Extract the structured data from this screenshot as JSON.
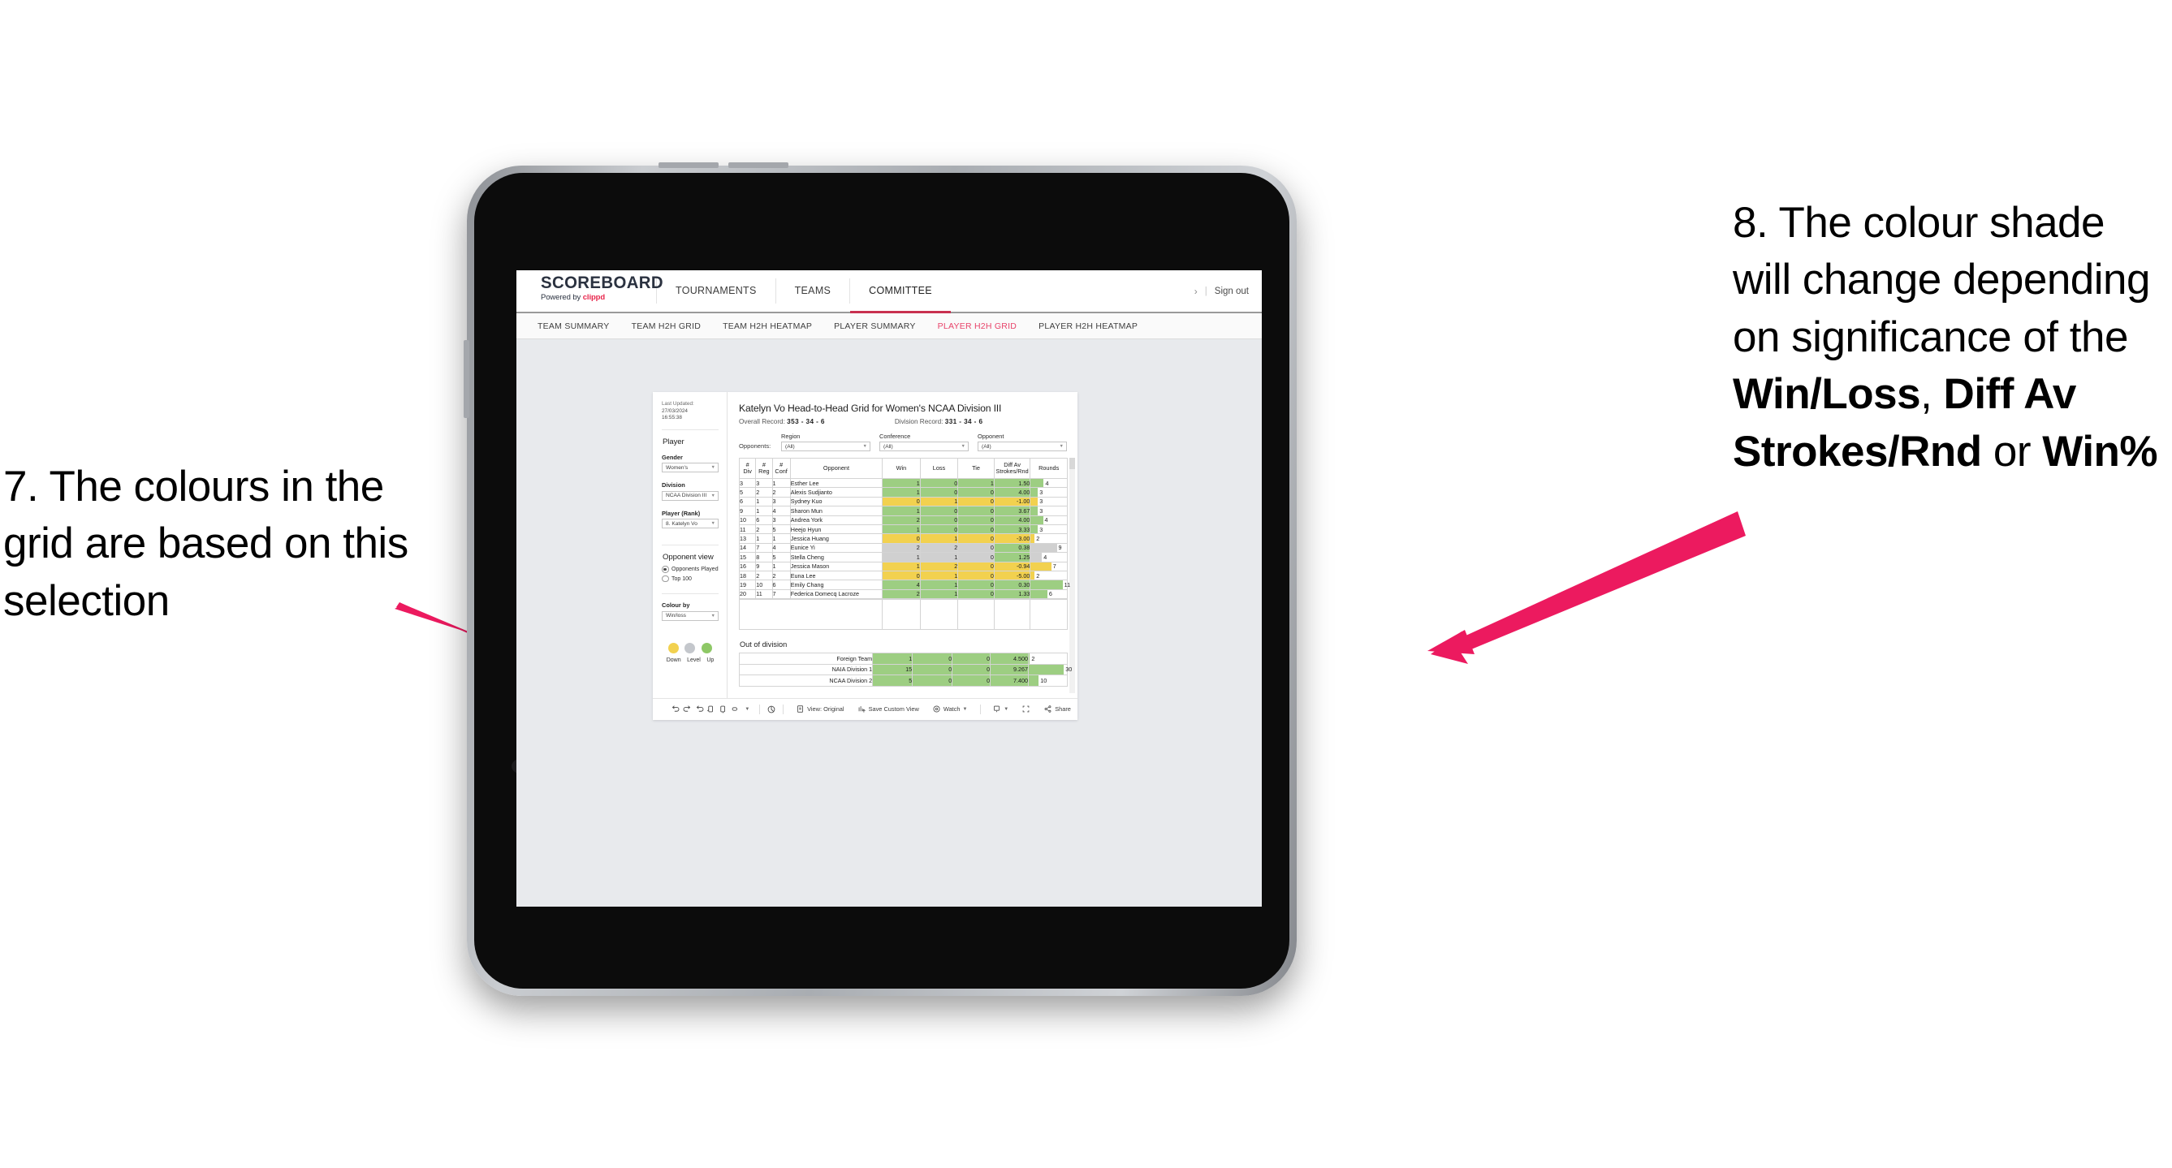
{
  "annotations": {
    "left": {
      "name": "annotation-7",
      "text": "7. The colours in the grid are based on this selection"
    },
    "right": {
      "name": "annotation-8",
      "prefix": "8. The colour shade will change depending on significance of the ",
      "bold1": "Win/Loss",
      "mid1": ", ",
      "bold2": "Diff Av Strokes/Rnd",
      "mid2": " or ",
      "bold3": "Win%"
    },
    "arrow_color": "#ec1a5f"
  },
  "app": {
    "brand": {
      "name": "SCOREBOARD",
      "powered_by": "Powered by ",
      "vendor": "clippd"
    },
    "top_nav": [
      {
        "label": "TOURNAMENTS",
        "active": false
      },
      {
        "label": "TEAMS",
        "active": false
      },
      {
        "label": "COMMITTEE",
        "active": true
      }
    ],
    "account": {
      "chevron": "›",
      "divider": "|",
      "sign_out": "Sign out"
    },
    "sub_nav": [
      {
        "label": "TEAM SUMMARY",
        "active": false
      },
      {
        "label": "TEAM H2H GRID",
        "active": false
      },
      {
        "label": "TEAM H2H HEATMAP",
        "active": false
      },
      {
        "label": "PLAYER SUMMARY",
        "active": false
      },
      {
        "label": "PLAYER H2H GRID",
        "active": true
      },
      {
        "label": "PLAYER H2H HEATMAP",
        "active": false
      }
    ]
  },
  "panel": {
    "last_updated_label": "Last Updated: ",
    "last_updated_value": "27/03/2024",
    "last_updated_time": "16:55:38",
    "heading": "Player",
    "fields": [
      {
        "label": "Gender",
        "value": "Women's"
      },
      {
        "label": "Division",
        "value": "NCAA Division III"
      },
      {
        "label": "Player (Rank)",
        "value": "8. Katelyn Vo"
      }
    ],
    "opponent_view": {
      "heading": "Opponent view",
      "options": [
        {
          "label": "Opponents Played",
          "selected": true
        },
        {
          "label": "Top 100",
          "selected": false
        }
      ]
    },
    "colour_by": {
      "label": "Colour by",
      "value": "Win/loss"
    },
    "legend": [
      {
        "label": "Down",
        "color": "#f2d14f"
      },
      {
        "label": "Level",
        "color": "#c4c7cc"
      },
      {
        "label": "Up",
        "color": "#8ec866"
      }
    ]
  },
  "main": {
    "title": "Katelyn Vo Head-to-Head Grid for Women's NCAA Division III",
    "overall_record_label": "Overall Record: ",
    "overall_record_value": "353 -  34 - 6",
    "division_record_label": "Division Record: ",
    "division_record_value": "331 -  34 - 6",
    "opponents_label": "Opponents:",
    "opponent_filters": [
      {
        "title": "Region",
        "value": "(All)"
      },
      {
        "title": "Conference",
        "value": "(All)"
      },
      {
        "title": "Opponent",
        "value": "(All)"
      }
    ],
    "out_of_division_title": "Out of division"
  },
  "chart_data": {
    "type": "table",
    "title": "Katelyn Vo Head-to-Head Grid for Women's NCAA Division III",
    "columns": [
      "# Div",
      "# Reg",
      "# Conf",
      "Opponent",
      "Win",
      "Loss",
      "Tie",
      "Diff Av Strokes/Rnd",
      "Rounds"
    ],
    "header_lines": [
      [
        "#",
        "Div"
      ],
      [
        "#",
        "Reg"
      ],
      [
        "#",
        "Conf"
      ],
      [
        "Opponent"
      ],
      [
        "Win"
      ],
      [
        "Loss"
      ],
      [
        "Tie"
      ],
      [
        "Diff Av",
        "Strokes/Rnd"
      ],
      [
        "Rounds"
      ]
    ],
    "color_scale": {
      "up": "#9dce82",
      "level": "#d0d0d0",
      "down": "#f2d14f"
    },
    "rows": [
      {
        "div": "3",
        "reg": "3",
        "conf": "1",
        "opponent": "Esther Lee",
        "win": "1",
        "loss": "0",
        "tie": "1",
        "diff": "1.50",
        "rounds": "4",
        "shade": "green",
        "bar_pct": 36
      },
      {
        "div": "5",
        "reg": "2",
        "conf": "2",
        "opponent": "Alexis Sudjianto",
        "win": "1",
        "loss": "0",
        "tie": "0",
        "diff": "4.00",
        "rounds": "3",
        "shade": "green",
        "bar_pct": 20
      },
      {
        "div": "6",
        "reg": "1",
        "conf": "3",
        "opponent": "Sydney Kuo",
        "win": "0",
        "loss": "1",
        "tie": "0",
        "diff": "-1.00",
        "rounds": "3",
        "shade": "yellow",
        "bar_pct": 20
      },
      {
        "div": "9",
        "reg": "1",
        "conf": "4",
        "opponent": "Sharon Mun",
        "win": "1",
        "loss": "0",
        "tie": "0",
        "diff": "3.67",
        "rounds": "3",
        "shade": "green",
        "bar_pct": 20
      },
      {
        "div": "10",
        "reg": "6",
        "conf": "3",
        "opponent": "Andrea York",
        "win": "2",
        "loss": "0",
        "tie": "0",
        "diff": "4.00",
        "rounds": "4",
        "shade": "green",
        "bar_pct": 34
      },
      {
        "div": "11",
        "reg": "2",
        "conf": "5",
        "opponent": "Heejo Hyun",
        "win": "1",
        "loss": "0",
        "tie": "0",
        "diff": "3.33",
        "rounds": "3",
        "shade": "green",
        "bar_pct": 20
      },
      {
        "div": "13",
        "reg": "1",
        "conf": "1",
        "opponent": "Jessica Huang",
        "win": "0",
        "loss": "1",
        "tie": "0",
        "diff": "-3.00",
        "rounds": "2",
        "shade": "yellow",
        "bar_pct": 11
      },
      {
        "div": "14",
        "reg": "7",
        "conf": "4",
        "opponent": "Eunice Yi",
        "win": "2",
        "loss": "2",
        "tie": "0",
        "diff": "0.38",
        "rounds": "9",
        "shade": "grey",
        "bar_pct": 72
      },
      {
        "div": "15",
        "reg": "8",
        "conf": "5",
        "opponent": "Stella Cheng",
        "win": "1",
        "loss": "1",
        "tie": "0",
        "diff": "1.25",
        "rounds": "4",
        "shade": "grey",
        "bar_pct": 31
      },
      {
        "div": "16",
        "reg": "9",
        "conf": "1",
        "opponent": "Jessica Mason",
        "win": "1",
        "loss": "2",
        "tie": "0",
        "diff": "-0.94",
        "rounds": "7",
        "shade": "yellow",
        "bar_pct": 57
      },
      {
        "div": "18",
        "reg": "2",
        "conf": "2",
        "opponent": "Euna Lee",
        "win": "0",
        "loss": "1",
        "tie": "0",
        "diff": "-5.00",
        "rounds": "2",
        "shade": "yellow",
        "bar_pct": 11
      },
      {
        "div": "19",
        "reg": "10",
        "conf": "6",
        "opponent": "Emily Chang",
        "win": "4",
        "loss": "1",
        "tie": "0",
        "diff": "0.30",
        "rounds": "11",
        "shade": "green",
        "bar_pct": 88
      },
      {
        "div": "20",
        "reg": "11",
        "conf": "7",
        "opponent": "Federica Domecq Lacroze",
        "win": "2",
        "loss": "1",
        "tie": "0",
        "diff": "1.33",
        "rounds": "6",
        "shade": "green",
        "bar_pct": 46
      }
    ],
    "out_of_division": {
      "title": "Out of division",
      "rows": [
        {
          "name": "Foreign Team",
          "win": "1",
          "loss": "0",
          "tie": "0",
          "diff": "4.500",
          "rounds": "2",
          "shade": "green",
          "bar_pct": 3
        },
        {
          "name": "NAIA Division 1",
          "win": "15",
          "loss": "0",
          "tie": "0",
          "diff": "9.267",
          "rounds": "30",
          "shade": "green",
          "bar_pct": 92
        },
        {
          "name": "NCAA Division 2",
          "win": "5",
          "loss": "0",
          "tie": "0",
          "diff": "7.400",
          "rounds": "10",
          "shade": "green",
          "bar_pct": 26
        }
      ]
    }
  },
  "toolbar": {
    "view_label": "View: Original",
    "save_label": "Save Custom View",
    "watch_label": "Watch",
    "share_label": "Share"
  }
}
